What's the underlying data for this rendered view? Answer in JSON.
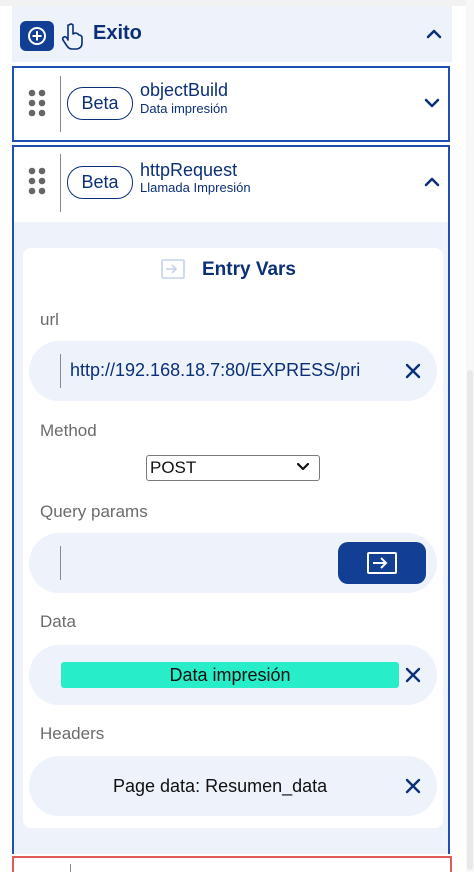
{
  "header": {
    "title": "Exito"
  },
  "cards": [
    {
      "badge": "Beta",
      "title": "objectBuild",
      "subtitle": "Data impresión"
    },
    {
      "badge": "Beta",
      "title": "httpRequest",
      "subtitle": "Llamada Impresión"
    }
  ],
  "entry_vars": {
    "title": "Entry Vars",
    "url": {
      "label": "url",
      "value": "http://192.168.18.7:80/EXPRESS/pri"
    },
    "method": {
      "label": "Method",
      "selected": "POST"
    },
    "query_params": {
      "label": "Query params",
      "value": ""
    },
    "data": {
      "label": "Data",
      "chip": "Data impresión",
      "chip_color": "#27eec8"
    },
    "headers": {
      "label": "Headers",
      "value": "Page data: Resumen_data"
    }
  },
  "colors": {
    "accent": "#0b3078",
    "button": "#123f93",
    "panel": "#edf2fb",
    "card_border": "#1f4fb0"
  },
  "icons": [
    "plus-circle-icon",
    "hand-pointer-icon",
    "chevron-up-icon",
    "chevron-down-icon",
    "drag-handle-icon",
    "enter-icon",
    "close-icon",
    "dropdown-arrow-icon"
  ]
}
